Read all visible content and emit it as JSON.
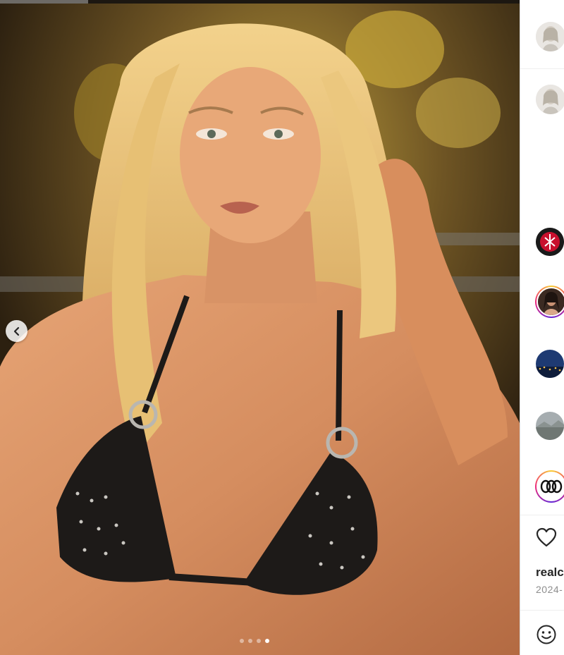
{
  "media": {
    "carousel": {
      "slide_count": 4,
      "active_index": 3
    },
    "prev_icon": "chevron-left-icon"
  },
  "sidebar": {
    "post_author": {
      "avatar_icon": "profile-avatar"
    },
    "comment_author": {
      "avatar_icon": "profile-avatar"
    },
    "likers": [
      {
        "avatar_icon": "trident-logo-avatar"
      },
      {
        "avatar_icon": "portrait-avatar-story-ring"
      },
      {
        "avatar_icon": "city-night-avatar"
      },
      {
        "avatar_icon": "landscape-avatar"
      },
      {
        "avatar_icon": "rings-logo-avatar-story-ring"
      }
    ],
    "actions": {
      "like_icon": "heart-icon",
      "emoji_icon": "smiley-icon"
    },
    "caption_user": "realc",
    "caption_date": "2024-"
  },
  "colors": {
    "ring_gradient": [
      "#f9ce34",
      "#ee2a7b",
      "#6228d7"
    ],
    "text_primary": "#262626",
    "text_secondary": "#8e8e8e"
  }
}
